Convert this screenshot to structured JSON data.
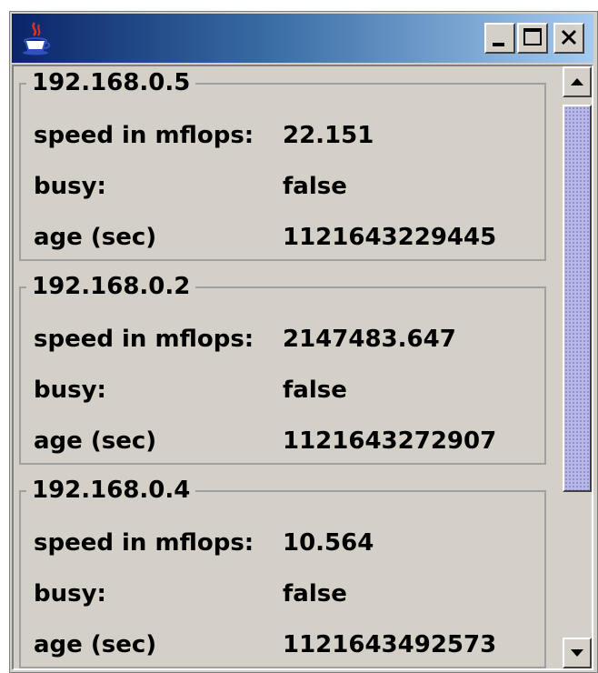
{
  "window": {
    "title": "",
    "icon": "java-coffee-cup-icon",
    "controls": {
      "minimize": "minimize-icon",
      "maximize": "maximize-icon",
      "close": "close-icon"
    }
  },
  "hosts": [
    {
      "address": "192.168.0.5",
      "speed_label": "speed in mflops:",
      "speed": "22.151",
      "busy_label": "busy:",
      "busy": "false",
      "age_label": "age (sec)",
      "age": "1121643229445"
    },
    {
      "address": "192.168.0.2",
      "speed_label": "speed in mflops:",
      "speed": "2147483.647",
      "busy_label": "busy:",
      "busy": "false",
      "age_label": "age (sec)",
      "age": "1121643272907"
    },
    {
      "address": "192.168.0.4",
      "speed_label": "speed in mflops:",
      "speed": "10.564",
      "busy_label": "busy:",
      "busy": "false",
      "age_label": "age (sec)",
      "age": "1121643492573"
    }
  ],
  "scrollbar": {
    "up_icon": "arrow-up-icon",
    "down_icon": "arrow-down-icon",
    "thumb_color": "#b8b8e8"
  },
  "colors": {
    "titlebar_start": "#0a246a",
    "titlebar_end": "#a6caf0",
    "window_bg": "#d4d0c8"
  }
}
